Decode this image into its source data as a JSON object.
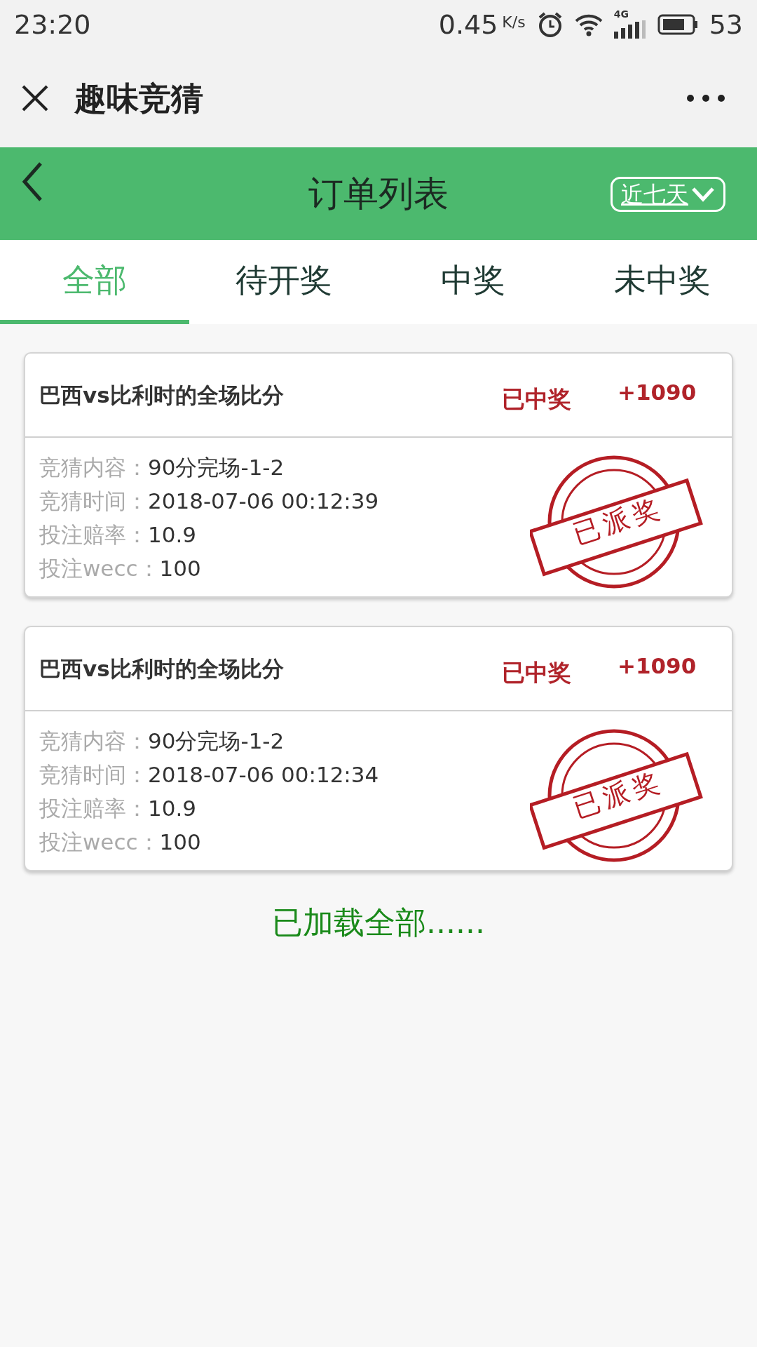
{
  "status_bar": {
    "time": "23:20",
    "speed": "0.45",
    "speed_unit": "K/s",
    "network": "4G",
    "battery": "53"
  },
  "title_bar": {
    "title": "趣味竞猜"
  },
  "header": {
    "title": "订单列表",
    "filter": "近七天"
  },
  "tabs": [
    {
      "label": "全部",
      "selected": true
    },
    {
      "label": "待开奖",
      "selected": false
    },
    {
      "label": "中奖",
      "selected": false
    },
    {
      "label": "未中奖",
      "selected": false
    }
  ],
  "orders": [
    {
      "title": "巴西vs比利时的全场比分",
      "status": "已中奖",
      "amount": "+1090",
      "stamp": "已派奖",
      "fields": [
        {
          "label": "竞猜内容：",
          "value": "90分完场-1-2"
        },
        {
          "label": "竞猜时间：",
          "value": "2018-07-06 00:12:39"
        },
        {
          "label": "投注赔率：",
          "value": "10.9"
        },
        {
          "label": "投注wecc：",
          "value": "100"
        }
      ]
    },
    {
      "title": "巴西vs比利时的全场比分",
      "status": "已中奖",
      "amount": "+1090",
      "stamp": "已派奖",
      "fields": [
        {
          "label": "竞猜内容：",
          "value": "90分完场-1-2"
        },
        {
          "label": "竞猜时间：",
          "value": "2018-07-06 00:12:34"
        },
        {
          "label": "投注赔率：",
          "value": "10.9"
        },
        {
          "label": "投注wecc：",
          "value": "100"
        }
      ]
    }
  ],
  "footer": "已加载全部......"
}
